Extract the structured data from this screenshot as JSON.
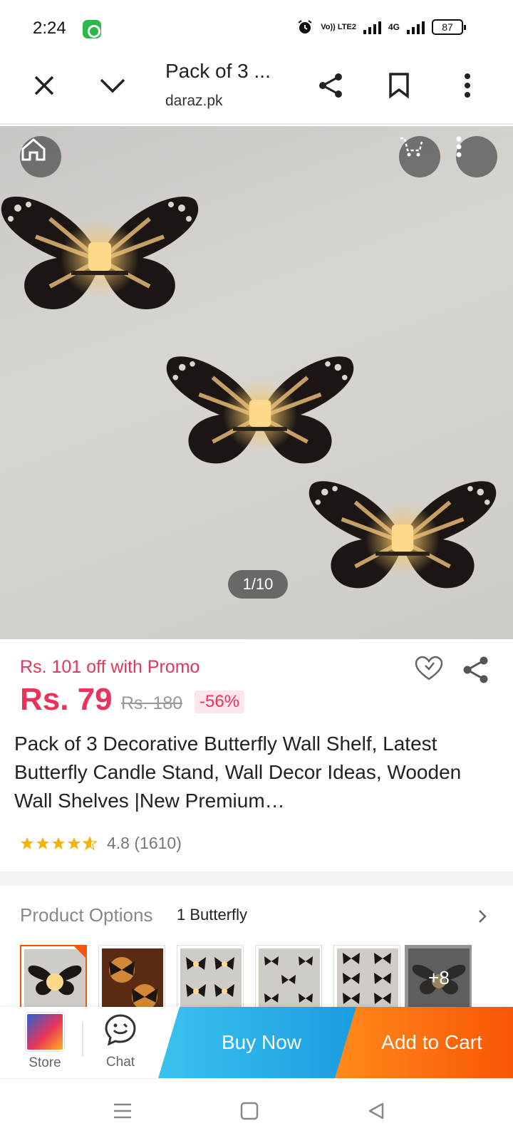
{
  "status_bar": {
    "time": "2:24",
    "network_label": "Vo)) LTE2",
    "network_type": "4G",
    "battery": "87",
    "icons": [
      "app-notification-icon",
      "alarm-icon",
      "signal-icon",
      "battery-icon"
    ]
  },
  "browser": {
    "page_title": "Pack of 3 ...",
    "url": "daraz.pk",
    "icons": [
      "close-icon",
      "chevron-down-icon",
      "share-icon",
      "bookmark-icon",
      "more-vert-icon"
    ]
  },
  "gallery": {
    "counter": "1/10",
    "icons": [
      "home-icon",
      "cart-icon",
      "more-vert-icon"
    ]
  },
  "product": {
    "promo": "Rs. 101 off with Promo",
    "price": "Rs. 79",
    "old_price": "Rs. 180",
    "discount": "-56%",
    "title": "Pack of 3 Decorative Butterfly Wall Shelf, Latest Butterfly Candle Stand, Wall Decor Ideas, Wooden Wall Shelves |New Premium…",
    "rating_value": 4.8,
    "rating_text": "4.8 (1610)",
    "star_color": "#f5b400"
  },
  "options": {
    "label": "Product Options",
    "selected": "1 Butterfly",
    "more_count": "+8"
  },
  "action_bar": {
    "store_label": "Store",
    "chat_label": "Chat",
    "buy_now": "Buy Now",
    "add_to_cart": "Add to Cart"
  },
  "colors": {
    "accent_red": "#e8345a",
    "daraz_orange": "#f85606",
    "buy_blue": "#1a9be0"
  }
}
